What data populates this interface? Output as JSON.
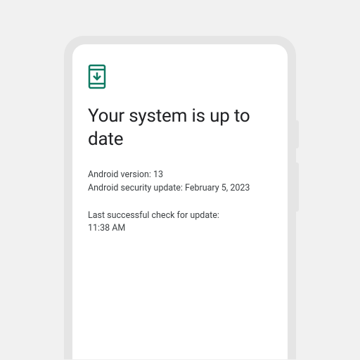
{
  "update": {
    "title": "Your system is up to date",
    "android_version_line": "Android version: 13",
    "security_update_line": "Android security update: February 5, 2023",
    "last_check_label": "Last successful check for update:",
    "last_check_time": "11:38 AM"
  },
  "colors": {
    "accent": "#0f7a63"
  }
}
